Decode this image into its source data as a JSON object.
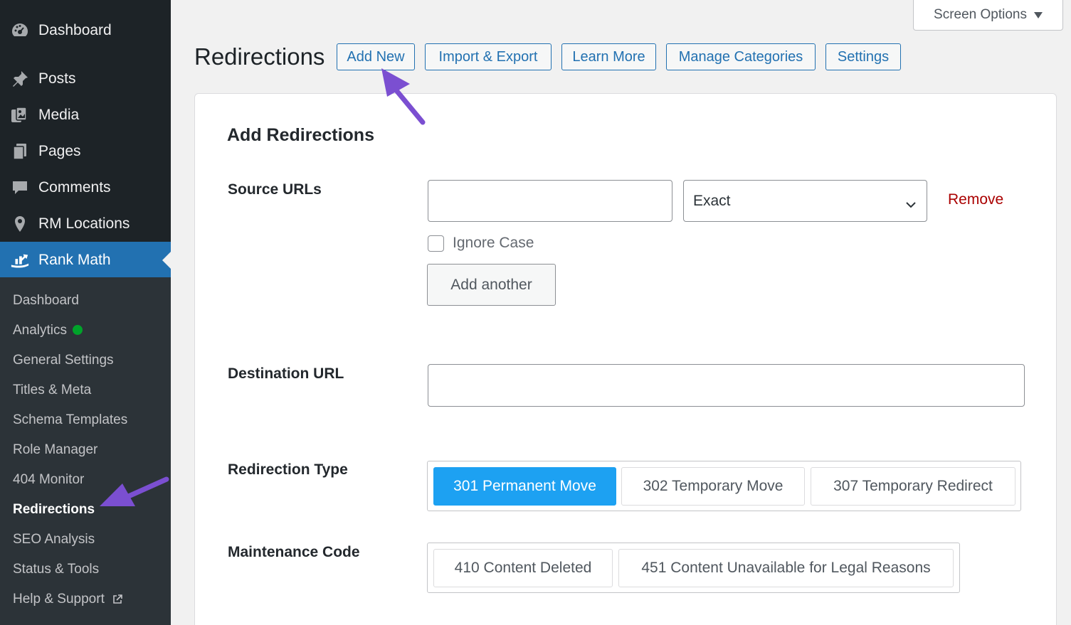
{
  "sidebar": {
    "menu": [
      {
        "label": "Dashboard",
        "icon": "dashboard-icon"
      },
      {
        "label": "Posts",
        "icon": "pin-icon"
      },
      {
        "label": "Media",
        "icon": "media-icon"
      },
      {
        "label": "Pages",
        "icon": "pages-icon"
      },
      {
        "label": "Comments",
        "icon": "comment-icon"
      },
      {
        "label": "RM Locations",
        "icon": "location-pin-icon"
      },
      {
        "label": "Rank Math",
        "icon": "rank-math-icon"
      }
    ],
    "submenu": [
      {
        "label": "Dashboard"
      },
      {
        "label": "Analytics"
      },
      {
        "label": "General Settings"
      },
      {
        "label": "Titles & Meta"
      },
      {
        "label": "Schema Templates"
      },
      {
        "label": "Role Manager"
      },
      {
        "label": "404 Monitor"
      },
      {
        "label": "Redirections"
      },
      {
        "label": "SEO Analysis"
      },
      {
        "label": "Status & Tools"
      },
      {
        "label": "Help & Support"
      }
    ]
  },
  "screen_options": "Screen Options",
  "header": {
    "title": "Redirections",
    "buttons": [
      "Add New",
      "Import & Export",
      "Learn More",
      "Manage Categories",
      "Settings"
    ]
  },
  "form": {
    "title": "Add Redirections",
    "source_urls": {
      "label": "Source URLs",
      "value": "",
      "match_select": "Exact",
      "remove": "Remove",
      "ignore_case": "Ignore Case",
      "add_another": "Add another"
    },
    "destination": {
      "label": "Destination URL",
      "value": ""
    },
    "redirection_type": {
      "label": "Redirection Type",
      "options": [
        "301 Permanent Move",
        "302 Temporary Move",
        "307 Temporary Redirect"
      ],
      "selected": "301 Permanent Move"
    },
    "maintenance_code": {
      "label": "Maintenance Code",
      "options": [
        "410 Content Deleted",
        "451 Content Unavailable for Legal Reasons"
      ]
    }
  },
  "colors": {
    "sidebar_bg": "#1d2327",
    "active_menu": "#2271b1",
    "selected_option": "#1da1f2",
    "annotation_arrow": "#7b4fd1",
    "remove_link": "#aa0000",
    "status_dot": "#00a32a"
  }
}
